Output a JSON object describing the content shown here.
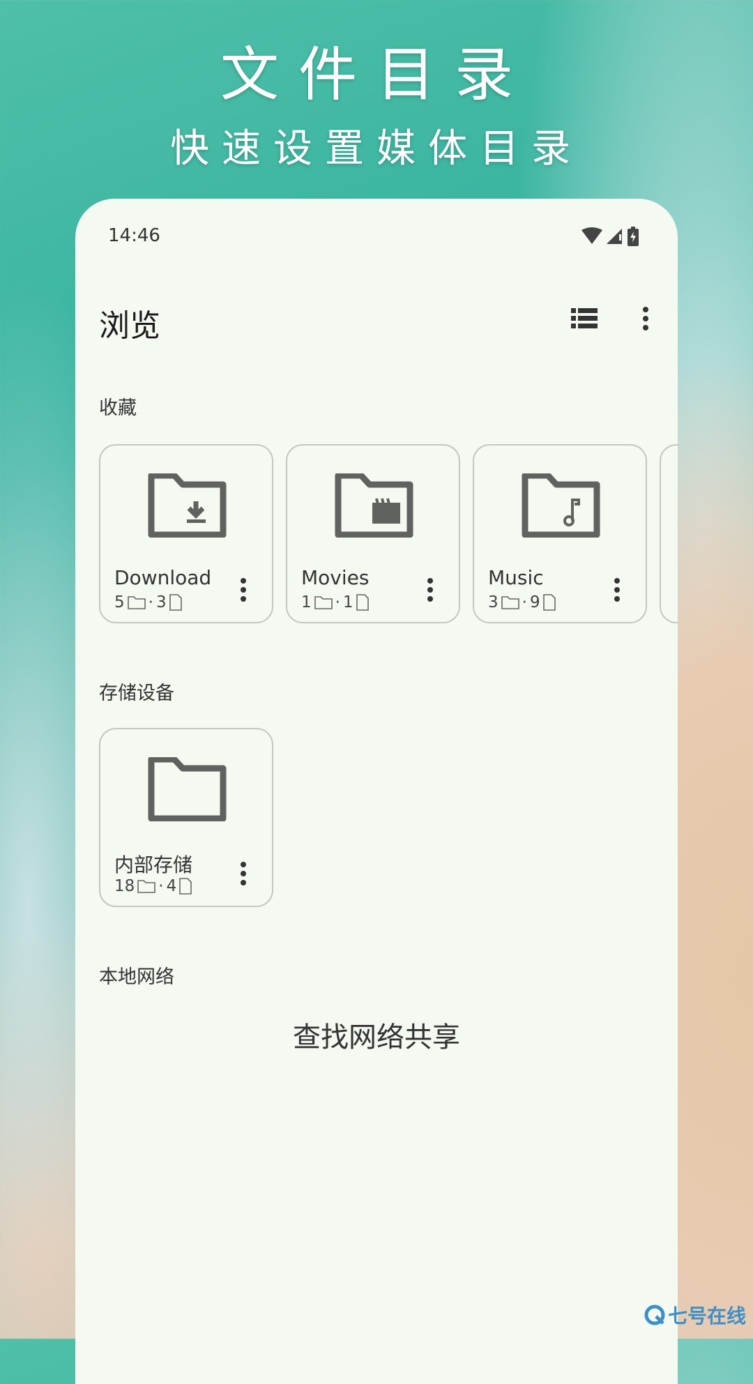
{
  "hero": {
    "title": "文件目录",
    "subtitle": "快速设置媒体目录"
  },
  "status_bar": {
    "time": "14:46",
    "icons": [
      "wifi-icon",
      "signal-icon",
      "battery-charging-icon"
    ]
  },
  "app_bar": {
    "title": "浏览",
    "actions": [
      "list-view-icon",
      "more-vert-icon"
    ]
  },
  "sections": {
    "favorites": {
      "label": "收藏",
      "items": [
        {
          "name": "Download",
          "folders": "5",
          "files": "3",
          "icon": "folder-download-icon"
        },
        {
          "name": "Movies",
          "folders": "1",
          "files": "1",
          "icon": "folder-movie-icon"
        },
        {
          "name": "Music",
          "folders": "3",
          "files": "9",
          "icon": "folder-music-icon"
        }
      ]
    },
    "storage": {
      "label": "存储设备",
      "items": [
        {
          "name": "内部存储",
          "folders": "18",
          "files": "4",
          "icon": "folder-icon"
        }
      ]
    },
    "network": {
      "label": "本地网络",
      "find_label": "查找网络共享"
    }
  },
  "separator": "·",
  "watermark": "七号在线",
  "colors": {
    "icon": "#5f625e",
    "panel": "#f4f9f1",
    "watermark": "#3d8fc9"
  }
}
